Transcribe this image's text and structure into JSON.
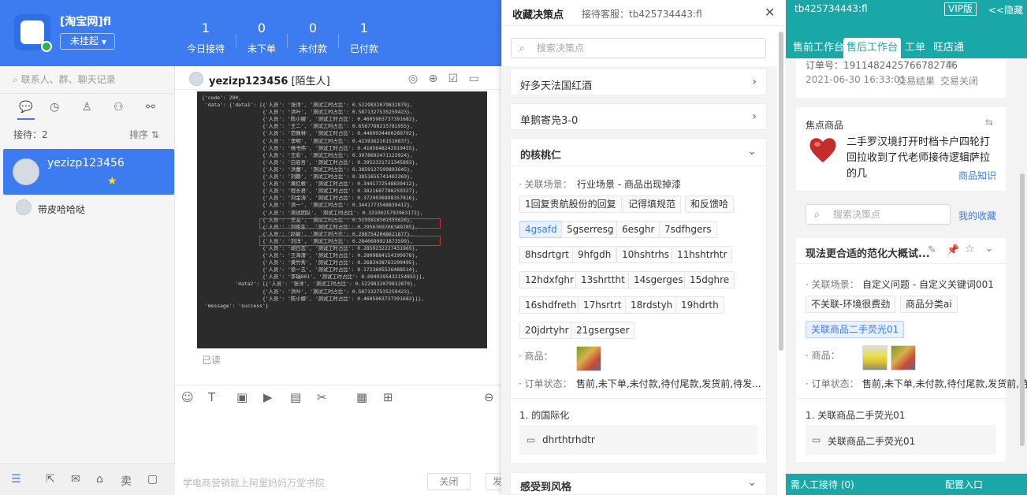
{
  "header": {
    "shop_name": "[淘宝网]fl",
    "status": "未挂起",
    "stats": [
      {
        "value": "1",
        "label": "今日接待"
      },
      {
        "value": "0",
        "label": "未下单"
      },
      {
        "value": "0",
        "label": "未付款"
      },
      {
        "value": "1",
        "label": "已付款"
      }
    ]
  },
  "sidebar": {
    "search_placeholder": "联系人、群、聊天记录",
    "reception_label": "接待：2",
    "sort_label": "排序 ⇅",
    "contacts": [
      {
        "name": "yezizp123456"
      },
      {
        "name": "带皮哈哈哒"
      }
    ]
  },
  "chat": {
    "title": "yezizp123456",
    "title_tag": "[陌生人]",
    "read_status": "已读",
    "footer_ad": "学电商营销就上阿里妈妈万堂书院",
    "close_label": "关闭",
    "send_label": "发",
    "code_lines": [
      "{'code': 200,",
      " 'data': {'data1': [{'人员': '张洋', '测试工时占比': 0.5229832079832879},",
      "                    {'人员': '洪叶', '测试工时占比': 0.5871327535259423},",
      "                    {'人员': '陈小娜', '测试工时占比': 0.4605963737391682},",
      "                    {'人员': '王二', '测试工时占比': 0.6587788215781955},",
      "                    {'人员': '范佩林', '测试工时占比': 0.4469934460289792},",
      "                    {'人员': '李明', '测试工时占比': 0.4239362161510837},",
      "                    {'人员': '杨书伟', '测试工时占比': 0.4105648242919455},",
      "                    {'人员': '王彩', '测试工时占比': 0.3978692471123924},",
      "                    {'人员': '白启吾', '测试工时占比': 0.3952331721345893},",
      "                    {'人员': '洪蕾', '测试工时占比': 0.3859127599893645},",
      "                    {'人员': '刘鹏', '测试工时占比': 0.3851655741402269},",
      "                    {'人员': '黄红根', '测试工时占比': 0.3441772548839412},",
      "                    {'人员': '程长君', '测试工时占比': 0.3821687788259327},",
      "                    {'人员': '刘金涛', '测试工时占比': 0.3729036898357816},",
      "                    {'人员': '洪一', '测试工时占比': 0.3441773548839412},",
      "                    {'人员': '测试团队', '测试工时占比': 0.3319025792963172},",
      "                    {'人员': '王龙', '测试工时占比': 0.3155816361555626},",
      "                    {'人员': '刘俊生', '测试工时占比': 0.2956369266349285},",
      "                    {'人员': '赵敏', '测试工时占比': 0.2987542048621877},",
      "                    {'人员': '刘洋', '测试工时占比': 0.2840699921873599},",
      "                    {'人员': '胡日志', '测试工时占比': 0.2859232227431965},",
      "                    {'人员': '王海清', '测试工时占比': 0.2809884154199978},",
      "                    {'人员': '黄竹秀', '测试工时占比': 0.2683438763299495},",
      "                    {'人员': '徐一五', '测试工时占比': 0.1723605526488514},",
      "                    {'人员': '李瑞801', '测试工时占比': 0.0949395432154855}],",
      "           'data2': [{'人员': '张洋', '测试工时占比': 0.5229832079832879},",
      "                    {'人员': '洪叶', '测试工时占比': 0.5871327535259423},",
      "                    {'人员': '陈小娜', '测试工时占比': 0.4605963737391682}]},",
      " 'message': 'success'}"
    ]
  },
  "modal": {
    "title": "收藏决策点",
    "subtitle": "接待客服：tb425734443:fl",
    "search_placeholder": "搜索决策点",
    "collapsed_items": [
      "好多天法国红酒",
      "单鹅寄凫3-0"
    ],
    "expanded": {
      "title": "的核桃仁",
      "scene_label": "· 关联场景：",
      "scene_value": "行业场景 - 商品出现掉漆",
      "tags": [
        "1回复贵航股份的回复",
        "记得填规范",
        "和反馈哈",
        "4gsafd",
        "5gserresg",
        "6esghr",
        "7sdfhgers",
        "8hsdrtgrt",
        "9hfgdh",
        "10hshtrhs",
        "11hshtrhtr",
        "12hdxfghr",
        "13shrttht",
        "14sgerges",
        "15dghre",
        "16shdfreth",
        "17hsrtrt",
        "18rdstyh",
        "19hdrth",
        "20jdrtyhr",
        "21gsergser"
      ],
      "goods_label": "· 商品：",
      "order_label": "· 订单状态：",
      "order_value": "售前,未下单,未付款,待付尾款,发货前,待发...",
      "reply_title": "1. 的国际化",
      "reply_text": "dhrthtrhdtr"
    },
    "last_item": "感受到风格"
  },
  "right": {
    "user": "tb425734443:fl",
    "vip": "VIP版",
    "hide": "<<隐藏",
    "tabs": [
      "售前工作台",
      "售后工作台",
      "工单",
      "旺店通"
    ],
    "order_no": "订单号：1911482425766782746",
    "order_time": "2021-06-30 16:33:01",
    "order_result": "交易结果",
    "order_state": "交易关闭",
    "focus_title": "焦点商品",
    "focus_text": "二手罗汉境打开时档卡户四轮打回拉收到了代老师接待逻辑萨拉的几",
    "focus_link": "商品知识",
    "search_placeholder": "搜索决策点",
    "my_fav": "我的收藏",
    "decision": {
      "title": "现法更合适的范化大概试...",
      "scene_label": "· 关联场景：",
      "scene_value": "自定义问题 - 自定义关键词001",
      "tags": [
        "不关联-环境很费劲",
        "商品分类ai",
        "关联商品二手荧光01"
      ],
      "goods_label": "· 商品：",
      "order_label": "· 订单状态：",
      "order_value": "售前,未下单,未付款,待付尾款,发货前,待发.",
      "reply_title": "1. 关联商品二手荧光01",
      "reply_text": "关联商品二手荧光01"
    },
    "bottom_left": "需人工接待 (0)",
    "bottom_right": "配置入口"
  }
}
